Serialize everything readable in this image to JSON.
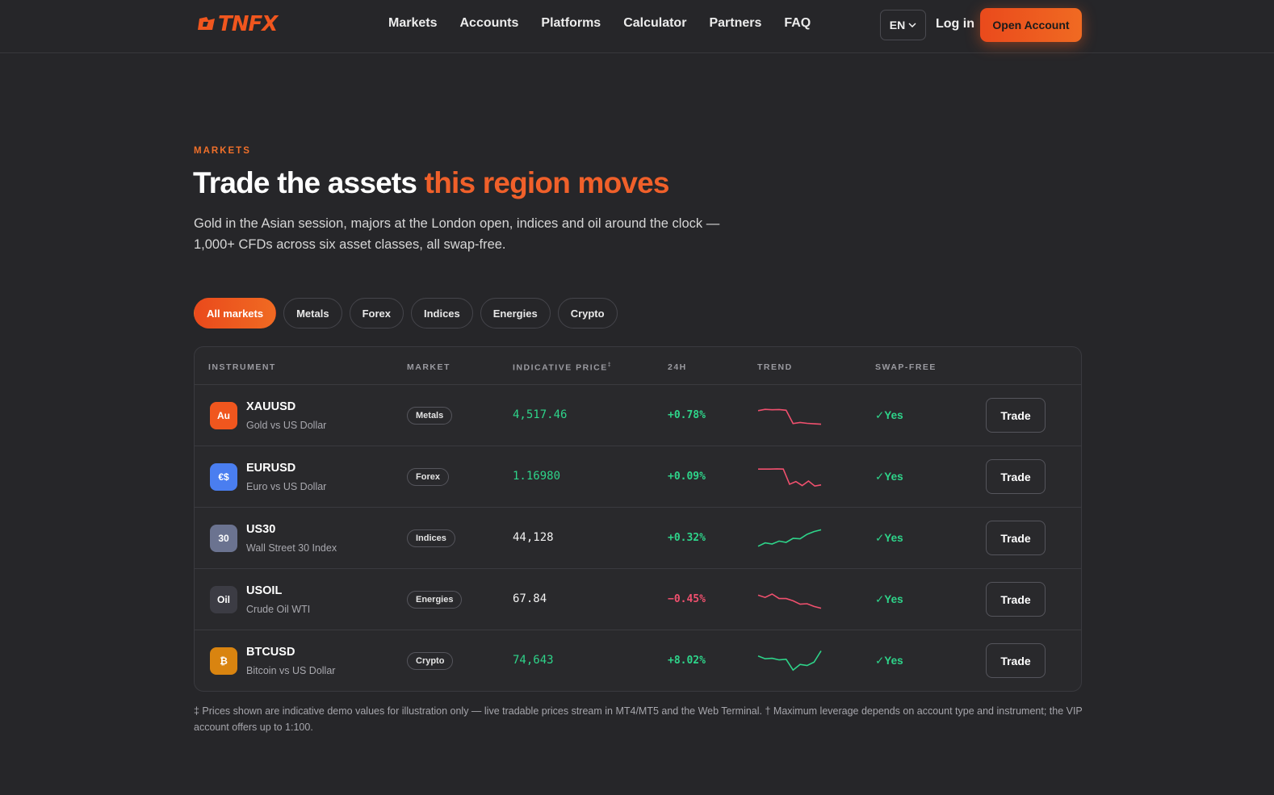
{
  "brand": {
    "name": "TNFX",
    "accent": "#f0561e"
  },
  "nav": [
    {
      "label": "Markets"
    },
    {
      "label": "Accounts"
    },
    {
      "label": "Platforms"
    },
    {
      "label": "Calculator"
    },
    {
      "label": "Partners"
    },
    {
      "label": "FAQ"
    }
  ],
  "header": {
    "lang": "EN",
    "login": "Log in",
    "cta": "Open Account"
  },
  "hero": {
    "eyebrow": "MARKETS",
    "title_plain": "Trade the assets ",
    "title_accent": "this region moves",
    "subtitle": "Gold in the Asian session, majors at the London open, indices and oil around the clock — 1,000+ CFDs across six asset classes, all swap-free."
  },
  "filters": [
    {
      "label": "All markets",
      "active": true
    },
    {
      "label": "Metals",
      "active": false
    },
    {
      "label": "Forex",
      "active": false
    },
    {
      "label": "Indices",
      "active": false
    },
    {
      "label": "Energies",
      "active": false
    },
    {
      "label": "Crypto",
      "active": false
    }
  ],
  "table": {
    "headers": {
      "instrument": "INSTRUMENT",
      "market": "MARKET",
      "price": "INDICATIVE PRICE",
      "price_mark": "‡",
      "change": "24H",
      "trend": "TREND",
      "swap": "SWAP-FREE"
    },
    "rows": [
      {
        "badge": "Au",
        "badge_color": "#f0561e",
        "symbol": "XAUUSD",
        "name": "Gold vs US Dollar",
        "market": "Metals",
        "price": "4,517.46",
        "price_color": "#2ed48a",
        "change": "+0.78%",
        "change_color": "#2ed48a",
        "trend_color": "#f0506e",
        "trend": [
          0.72,
          0.78,
          0.76,
          0.77,
          0.74,
          0.15,
          0.2,
          0.16,
          0.14,
          0.12
        ],
        "swap": "✓Yes",
        "trade": "Trade"
      },
      {
        "badge": "€$",
        "badge_color": "#4a7ef0",
        "symbol": "EURUSD",
        "name": "Euro vs US Dollar",
        "market": "Forex",
        "price": "1.16980",
        "price_color": "#2ed48a",
        "change": "+0.09%",
        "change_color": "#2ed48a",
        "trend_color": "#f0506e",
        "trend": [
          0.85,
          0.85,
          0.85,
          0.86,
          0.85,
          0.18,
          0.3,
          0.12,
          0.32,
          0.1,
          0.15
        ],
        "swap": "✓Yes",
        "trade": "Trade"
      },
      {
        "badge": "30",
        "badge_color": "#6b7390",
        "symbol": "US30",
        "name": "Wall Street 30 Index",
        "market": "Indices",
        "price": "44,128",
        "price_color": "#f1f1f1",
        "change": "+0.32%",
        "change_color": "#2ed48a",
        "trend_color": "#2ed48a",
        "trend": [
          0.15,
          0.3,
          0.25,
          0.38,
          0.32,
          0.5,
          0.48,
          0.68,
          0.8,
          0.88
        ],
        "swap": "✓Yes",
        "trade": "Trade"
      },
      {
        "badge": "Oil",
        "badge_color": "#3c3c44",
        "symbol": "USOIL",
        "name": "Crude Oil WTI",
        "market": "Energies",
        "price": "67.84",
        "price_color": "#f1f1f1",
        "change": "−0.45%",
        "change_color": "#f0506e",
        "trend_color": "#f0506e",
        "trend": [
          0.7,
          0.6,
          0.75,
          0.55,
          0.55,
          0.45,
          0.3,
          0.32,
          0.2,
          0.12
        ],
        "swap": "✓Yes",
        "trade": "Trade"
      },
      {
        "badge": "₿",
        "badge_color": "#d98410",
        "symbol": "BTCUSD",
        "name": "Bitcoin vs US Dollar",
        "market": "Crypto",
        "price": "74,643",
        "price_color": "#2ed48a",
        "change": "+8.02%",
        "change_color": "#2ed48a",
        "trend_color": "#2ed48a",
        "trend": [
          0.72,
          0.6,
          0.62,
          0.55,
          0.58,
          0.1,
          0.35,
          0.3,
          0.45,
          0.95
        ],
        "swap": "✓Yes",
        "trade": "Trade"
      }
    ]
  },
  "footnote": "‡ Prices shown are indicative demo values for illustration only — live tradable prices stream in MT4/MT5 and the Web Terminal. † Maximum leverage depends on account type and instrument; the VIP account offers up to 1:100."
}
